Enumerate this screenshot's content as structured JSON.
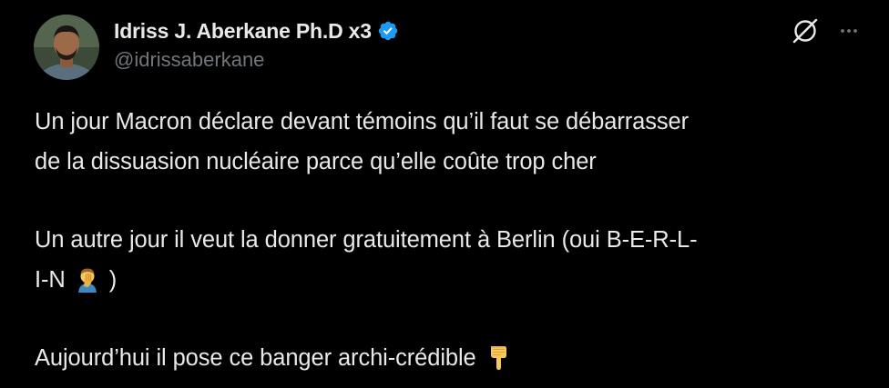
{
  "author": {
    "display_name": "Idriss J. Aberkane Ph.D x3",
    "handle": "@idrissaberkane",
    "verified": true,
    "verified_color": "#1d9bf0"
  },
  "actions": {
    "grok_icon": "grok-icon",
    "more_icon": "more-horizontal-icon"
  },
  "tweet": {
    "paragraph_1_line_1": "Un jour Macron déclare devant témoins qu’il faut se débarrasser",
    "paragraph_1_line_2": "de la dissuasion nucléaire parce qu’elle coûte trop cher",
    "paragraph_2_line_1": "Un autre jour il veut la donner gratuitement à Berlin (oui B-E-R-L-",
    "paragraph_2_line_2_before": "I-N",
    "paragraph_2_line_2_after": ")",
    "paragraph_3": "Aujourd’hui il pose ce banger archi-crédible",
    "emoji_1": "facepalm-emoji",
    "emoji_2": "pointing-down-emoji"
  },
  "colors": {
    "background": "#000000",
    "text_primary": "#e7e9ea",
    "text_secondary": "#71767b"
  }
}
